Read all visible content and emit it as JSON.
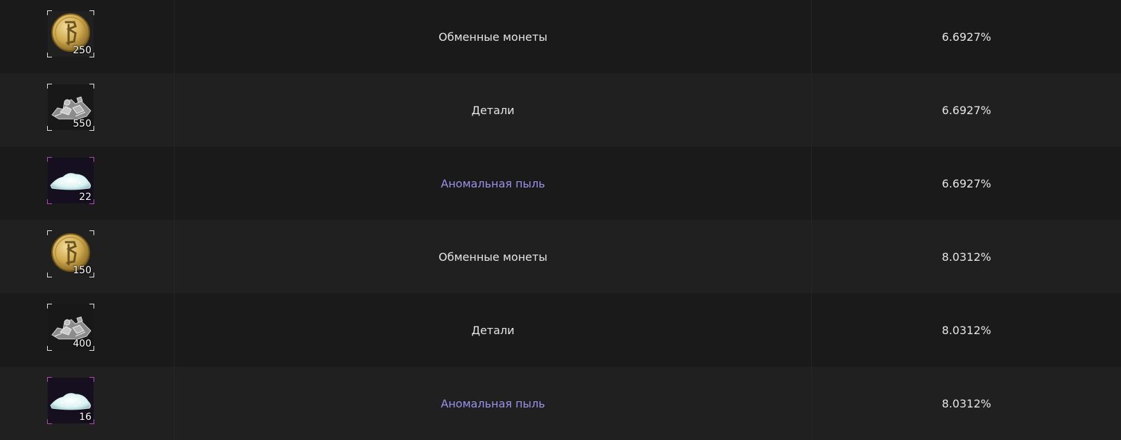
{
  "drops": [
    {
      "icon": "exchange-coin-icon",
      "quantity": "250",
      "name": "Обменные монеты",
      "chance": "6.6927%",
      "rarity": "common"
    },
    {
      "icon": "parts-icon",
      "quantity": "550",
      "name": "Детали",
      "chance": "6.6927%",
      "rarity": "common"
    },
    {
      "icon": "anomalous-dust-icon",
      "quantity": "22",
      "name": "Аномальная пыль",
      "chance": "6.6927%",
      "rarity": "rare"
    },
    {
      "icon": "exchange-coin-icon",
      "quantity": "150",
      "name": "Обменные монеты",
      "chance": "8.0312%",
      "rarity": "common"
    },
    {
      "icon": "parts-icon",
      "quantity": "400",
      "name": "Детали",
      "chance": "8.0312%",
      "rarity": "common"
    },
    {
      "icon": "anomalous-dust-icon",
      "quantity": "16",
      "name": "Аномальная пыль",
      "chance": "8.0312%",
      "rarity": "rare"
    }
  ],
  "colors": {
    "background_dark": "#1a1a1a",
    "background_light": "#202020",
    "text": "#e6e6e6",
    "rare_text": "#9a93ea",
    "rare_frame": "#b14fb1"
  }
}
